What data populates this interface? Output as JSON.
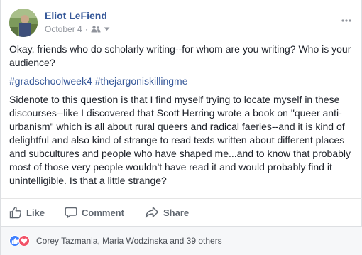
{
  "post": {
    "author": "Eliot LeFiend",
    "date": "October 4",
    "separator": "·",
    "text_main": "Okay, friends who do scholarly writing--for whom are you writing? Who is your audience?",
    "hashtags": [
      "#gradschoolweek4",
      "#thejargoniskillingme"
    ],
    "text_sidenote": "Sidenote to this question is that I find myself trying to locate myself in these discourses--like I discovered that Scott Herring wrote a book on \"queer anti-urbanism\" which is all about rural queers and radical faeries--and it is kind of delightful and also kind of strange to read texts written about different places and subcultures and people who have shaped me...and to know that probably most of those very people wouldn't have read it and would probably find it unintelligible. Is that a little strange?"
  },
  "actions": {
    "like_label": "Like",
    "comment_label": "Comment",
    "share_label": "Share"
  },
  "reactions": {
    "types": [
      "like",
      "love"
    ],
    "summary": "Corey Tazmania, Maria Wodzinska and 39 others"
  },
  "colors": {
    "link": "#365899",
    "muted": "#90949c",
    "like": "#4080ff",
    "love": "#f25268"
  }
}
